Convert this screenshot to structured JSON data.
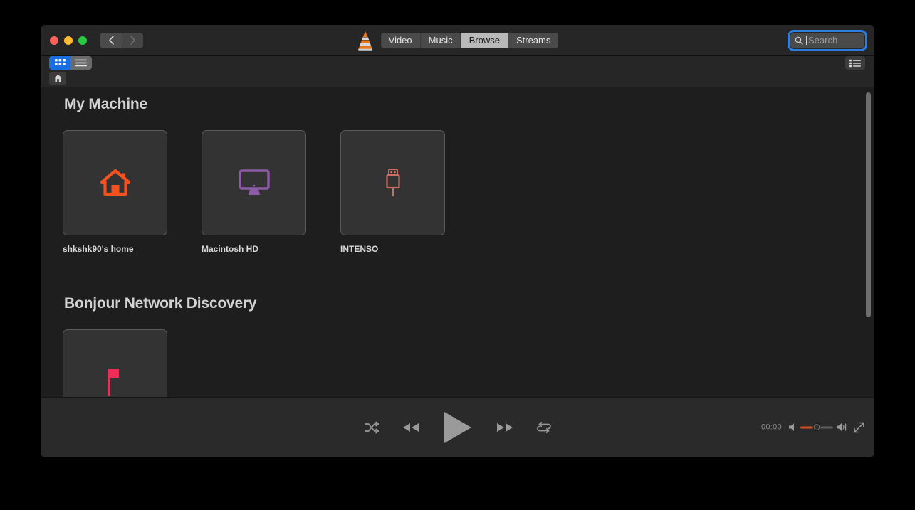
{
  "window": {
    "traffic_lights": [
      {
        "name": "close",
        "color": "#ff5f57"
      },
      {
        "name": "minimize",
        "color": "#febc2e"
      },
      {
        "name": "zoom",
        "color": "#28c840"
      }
    ],
    "nav": {
      "back_label": "Back",
      "forward_label": "Forward"
    }
  },
  "titlebar": {
    "app_logo": "vlc-cone-icon",
    "tabs": [
      {
        "label": "Video",
        "active": false
      },
      {
        "label": "Music",
        "active": false
      },
      {
        "label": "Browse",
        "active": true
      },
      {
        "label": "Streams",
        "active": false
      }
    ],
    "search": {
      "icon": "search-icon",
      "placeholder": "Search",
      "value": "",
      "focused": true,
      "focus_color": "#2b7de0"
    }
  },
  "toolbar": {
    "view_modes": [
      {
        "name": "grid-view",
        "icon": "grid-icon",
        "active": true
      },
      {
        "name": "list-view",
        "icon": "list-icon",
        "active": false
      }
    ],
    "sidebar_toggle_icon": "playlist-panel-icon",
    "accent_color": "#1a6fe0"
  },
  "breadcrumb": {
    "items": [
      {
        "name": "home",
        "icon": "home-icon"
      }
    ]
  },
  "main": {
    "sections": [
      {
        "title": "My Machine",
        "items": [
          {
            "label": "shkshk90's home",
            "icon": "house-icon",
            "icon_color": "#f4511e"
          },
          {
            "label": "Macintosh HD",
            "icon": "imac-display-icon",
            "icon_color": "#8e5ba6"
          },
          {
            "label": "INTENSO",
            "icon": "usb-plug-icon",
            "icon_color": "#c96f64"
          }
        ]
      },
      {
        "title": "Bonjour Network Discovery",
        "items": [
          {
            "label": "",
            "icon": "flag-icon",
            "icon_color": "#ef2d56"
          }
        ]
      }
    ]
  },
  "player": {
    "controls": [
      {
        "name": "shuffle",
        "icon": "shuffle-icon"
      },
      {
        "name": "previous",
        "icon": "rewind-icon"
      },
      {
        "name": "play",
        "icon": "play-icon"
      },
      {
        "name": "next",
        "icon": "fast-forward-icon"
      },
      {
        "name": "repeat",
        "icon": "loop-icon"
      }
    ],
    "elapsed_time": "00:00",
    "volume": {
      "level_percent": 50,
      "fill_color": "#d2501e",
      "mute_icon": "speaker-low-icon",
      "max_icon": "speaker-high-icon"
    },
    "fullscreen_icon": "expand-icon"
  }
}
